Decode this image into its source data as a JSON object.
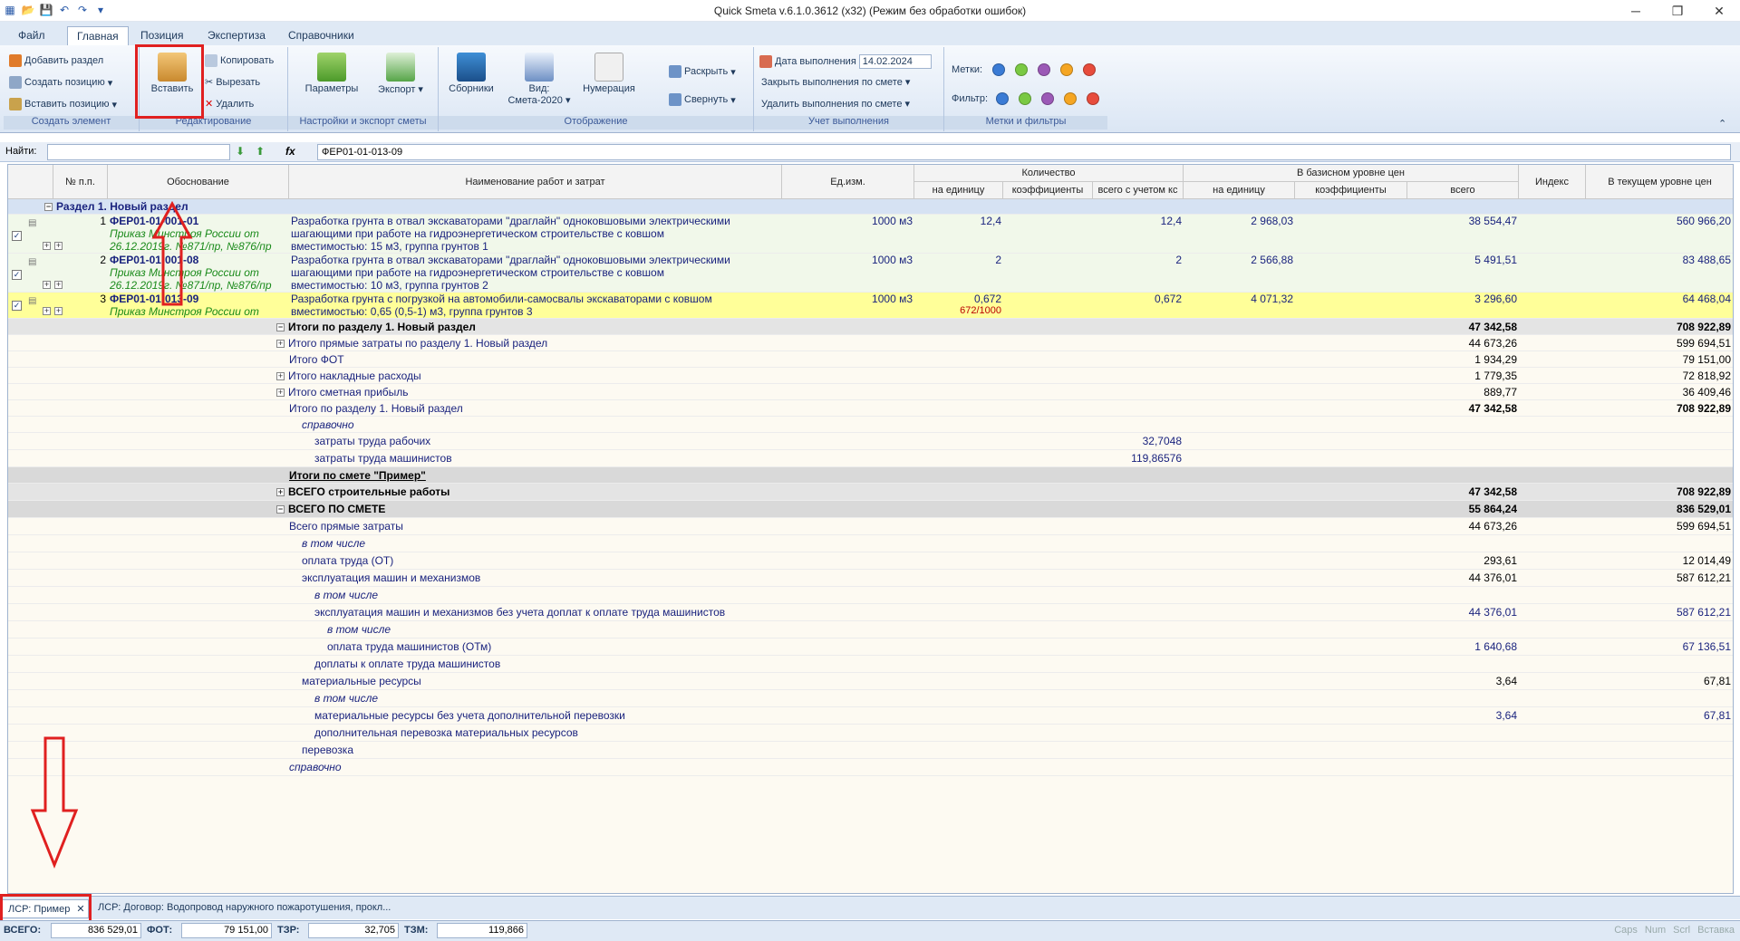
{
  "window": {
    "title": "Quick Smeta v.6.1.0.3612 (x32) (Режим без обработки ошибок)"
  },
  "tabs": [
    "Файл",
    "Главная",
    "Позиция",
    "Экспертиза",
    "Справочники"
  ],
  "ribbon": {
    "create": {
      "add_section": "Добавить раздел",
      "create_position": "Создать позицию",
      "insert_position": "Вставить позицию",
      "label": "Создать элемент"
    },
    "edit": {
      "paste": "Вставить",
      "copy": "Копировать",
      "cut": "Вырезать",
      "delete": "Удалить",
      "label": "Редактирование"
    },
    "settings": {
      "params": "Параметры",
      "export": "Экспорт",
      "label": "Настройки и экспорт сметы"
    },
    "display": {
      "collections": "Сборники",
      "view": "Вид:",
      "view2": "Смета-2020",
      "numbering": "Нумерация",
      "expand": "Раскрыть",
      "collapse": "Свернуть",
      "label": "Отображение"
    },
    "execution": {
      "date_label": "Дата выполнения",
      "date": "14.02.2024",
      "close": "Закрыть выполнения по смете",
      "remove": "Удалить выполнения по смете",
      "label": "Учет выполнения"
    },
    "marks": {
      "marks": "Метки:",
      "filter": "Фильтр:",
      "label": "Метки и фильтры"
    }
  },
  "find": {
    "label": "Найти:",
    "fx": "fx",
    "formula": "ФЕР01-01-013-09"
  },
  "headers": {
    "num": "№ п.п.",
    "basis": "Обоснование",
    "name": "Наименование работ и затрат",
    "unit": "Ед.изм.",
    "qty": "Количество",
    "qty_unit": "на единицу",
    "qty_coef": "коэффициенты",
    "qty_total": "всего с учетом кс",
    "base": "В базисном уровне цен",
    "base_unit": "на единицу",
    "base_coef": "коэффициенты",
    "base_total": "всего",
    "index": "Индекс",
    "current": "В текущем уровне цен"
  },
  "section": "Раздел 1. Новый раздел",
  "positions": [
    {
      "num": "1",
      "code": "ФЕР01-01-001-01",
      "order": "Приказ Минстроя России от",
      "order2": "26.12.2019г. №871/пр, №876/пр",
      "name1": "Разработка грунта в отвал экскаваторами \"драглайн\" одноковшовыми электрическими",
      "name2": "шагающими при работе на гидроэнергетическом строительстве с ковшом",
      "name3": "вместимостью: 15 м3, группа грунтов 1",
      "unit": "1000 м3",
      "qty": "12,4",
      "qty_total": "12,4",
      "base_unit": "2 968,03",
      "base_total": "38 554,47",
      "current": "560 966,20"
    },
    {
      "num": "2",
      "code": "ФЕР01-01-001-08",
      "order": "Приказ Минстроя России от",
      "order2": "26.12.2019г. №871/пр, №876/пр",
      "name1": "Разработка грунта в отвал экскаваторами \"драглайн\" одноковшовыми электрическими",
      "name2": "шагающими при работе на гидроэнергетическом строительстве с ковшом",
      "name3": "вместимостью: 10 м3, группа грунтов 2",
      "unit": "1000 м3",
      "qty": "2",
      "qty_total": "2",
      "base_unit": "2 566,88",
      "base_total": "5 491,51",
      "current": "83 488,65"
    },
    {
      "num": "3",
      "code": "ФЕР01-01-013-09",
      "order": "Приказ Минстроя России от",
      "name1": "Разработка грунта с погрузкой на автомобили-самосвалы экскаваторами с ковшом",
      "name2": "вместимостью: 0,65 (0,5-1) м3, группа грунтов 3",
      "unit": "1000 м3",
      "qty": "0,672",
      "qty2": "672/1000",
      "qty_total": "0,672",
      "base_unit": "4 071,32",
      "base_total": "3 296,60",
      "current": "64 468,04"
    }
  ],
  "summary": [
    {
      "label": "Итоги по разделу 1. Новый раздел",
      "base": "47 342,58",
      "cur": "708 922,89"
    },
    {
      "label": "Итого прямые затраты по разделу 1. Новый раздел",
      "base": "44 673,26",
      "cur": "599 694,51"
    },
    {
      "label": "Итого ФОТ",
      "base": "1 934,29",
      "cur": "79 151,00"
    },
    {
      "label": "Итого накладные расходы",
      "base": "1 779,35",
      "cur": "72 818,92"
    },
    {
      "label": "Итого сметная прибыль",
      "base": "889,77",
      "cur": "36 409,46"
    },
    {
      "label": "Итого по разделу 1. Новый раздел",
      "base": "47 342,58",
      "cur": "708 922,89"
    },
    {
      "label": "справочно"
    },
    {
      "label": "затраты труда рабочих",
      "qty": "32,7048"
    },
    {
      "label": "затраты труда машинистов",
      "qty": "119,86576"
    },
    {
      "label": "Итоги по смете \"Пример\""
    },
    {
      "label": "ВСЕГО строительные работы",
      "base": "47 342,58",
      "cur": "708 922,89"
    },
    {
      "label": "ВСЕГО ПО СМЕТЕ",
      "base": "55 864,24",
      "cur": "836 529,01"
    },
    {
      "label": "Всего прямые затраты",
      "base": "44 673,26",
      "cur": "599 694,51"
    },
    {
      "label": "в том числе"
    },
    {
      "label": "оплата труда (ОТ)",
      "base": "293,61",
      "cur": "12 014,49"
    },
    {
      "label": "эксплуатация машин и механизмов",
      "base": "44 376,01",
      "cur": "587 612,21"
    },
    {
      "label": "в том числе"
    },
    {
      "label": "эксплуатация машин и механизмов без учета доплат к оплате труда машинистов",
      "base": "44 376,01",
      "cur": "587 612,21"
    },
    {
      "label": "в том числе"
    },
    {
      "label": "оплата труда машинистов (ОТм)",
      "base": "1 640,68",
      "cur": "67 136,51"
    },
    {
      "label": "доплаты к оплате труда машинистов"
    },
    {
      "label": "материальные ресурсы",
      "base": "3,64",
      "cur": "67,81"
    },
    {
      "label": "в том числе"
    },
    {
      "label": "материальные ресурсы без учета дополнительной перевозки",
      "base": "3,64",
      "cur": "67,81"
    },
    {
      "label": "дополнительная перевозка материальных ресурсов"
    },
    {
      "label": "перевозка"
    },
    {
      "label": "справочно"
    }
  ],
  "doc_tabs": [
    "ЛСР: Пример",
    "ЛСР: Договор: Водопровод наружного пожаротушения, прокл..."
  ],
  "status": {
    "total_l": "ВСЕГО:",
    "total": "836 529,01",
    "fot_l": "ФОТ:",
    "fot": "79 151,00",
    "tzr_l": "ТЗР:",
    "tzr": "32,705",
    "tzm_l": "ТЗМ:",
    "tzm": "119,866",
    "caps": "Caps",
    "num": "Num",
    "scrl": "Scrl",
    "ins": "Вставка"
  }
}
